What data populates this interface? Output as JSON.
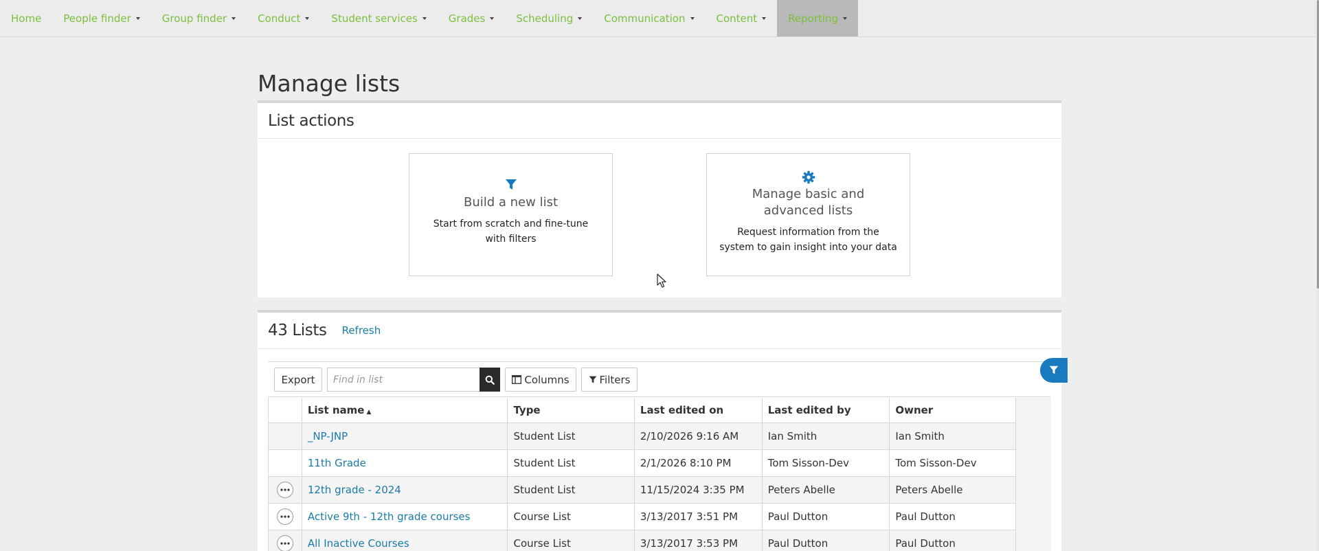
{
  "nav": {
    "items": [
      {
        "label": "Home",
        "dropdown": false
      },
      {
        "label": "People finder",
        "dropdown": true
      },
      {
        "label": "Group finder",
        "dropdown": true
      },
      {
        "label": "Conduct",
        "dropdown": true
      },
      {
        "label": "Student services",
        "dropdown": true
      },
      {
        "label": "Grades",
        "dropdown": true
      },
      {
        "label": "Scheduling",
        "dropdown": true
      },
      {
        "label": "Communication",
        "dropdown": true
      },
      {
        "label": "Content",
        "dropdown": true
      },
      {
        "label": "Reporting",
        "dropdown": true,
        "active": true
      }
    ]
  },
  "page": {
    "title": "Manage lists"
  },
  "actions": {
    "heading": "List actions",
    "build": {
      "icon": "filter-icon",
      "title": "Build a new list",
      "desc": "Start from scratch and fine-tune with filters"
    },
    "manage": {
      "icon": "gear-icon",
      "title_1": "Manage basic and",
      "title_2": "advanced lists",
      "desc": "Request information from the system to gain insight into your data"
    }
  },
  "lists": {
    "count": "43 Lists",
    "refresh": "Refresh",
    "toolbar": {
      "export": "Export",
      "search_placeholder": "Find in list",
      "columns": "Columns",
      "filters": "Filters"
    },
    "columns": {
      "name": "List name",
      "type": "Type",
      "edited_on": "Last edited on",
      "edited_by": "Last edited by",
      "owner": "Owner"
    },
    "sort": {
      "column": "List name",
      "direction": "ascending"
    },
    "rows": [
      {
        "name": "_NP-JNP",
        "type": "Student List",
        "edited_on": "2/10/2026 9:16 AM",
        "edited_by": "Ian Smith",
        "owner": "Ian Smith",
        "menu": false
      },
      {
        "name": "11th Grade",
        "type": "Student List",
        "edited_on": "2/1/2026 8:10 PM",
        "edited_by": "Tom Sisson-Dev",
        "owner": "Tom Sisson-Dev",
        "menu": false
      },
      {
        "name": "12th grade - 2024",
        "type": "Student List",
        "edited_on": "11/15/2024 3:35 PM",
        "edited_by": "Peters Abelle",
        "owner": "Peters Abelle",
        "menu": true
      },
      {
        "name": "Active 9th - 12th grade courses",
        "type": "Course List",
        "edited_on": "3/13/2017 3:51 PM",
        "edited_by": "Paul Dutton",
        "owner": "Paul Dutton",
        "menu": true
      },
      {
        "name": "All Inactive Courses",
        "type": "Course List",
        "edited_on": "3/13/2017 3:53 PM",
        "edited_by": "Paul Dutton",
        "owner": "Paul Dutton",
        "menu": true
      }
    ]
  },
  "colors": {
    "accent_green": "#7cbf3e",
    "link_blue": "#1a7ba8",
    "filter_blue": "#1a7ac0"
  }
}
